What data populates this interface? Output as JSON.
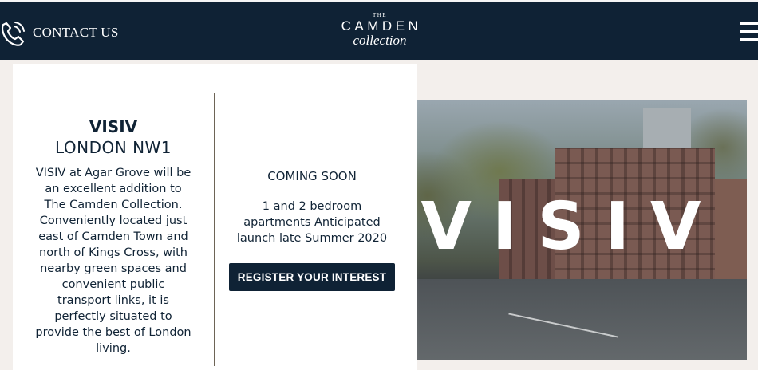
{
  "header": {
    "contact_label": "CONTACT US",
    "logo": {
      "the": "THE",
      "name": "CAMDEN",
      "sub": "collection"
    },
    "colors": {
      "background": "#0f2235",
      "text": "#ffffff"
    }
  },
  "development": {
    "name": "VISIV",
    "location": "LONDON NW1",
    "description": "VISIV at Agar Grove will be an excellent addition to The Camden Collection. Conveniently located just east of Camden Town and north of Kings Cross, with nearby green spaces and convenient public transport links, it is perfectly situated to provide the best of London living.",
    "status": "COMING SOON",
    "details": "1 and 2 bedroom apartments Anticipated launch late Summer 2020",
    "cta_label": "REGISTER YOUR INTEREST",
    "hero_title": "VISIV"
  },
  "icons": {
    "contact": "phone-icon",
    "menu": "hamburger-menu-icon"
  }
}
